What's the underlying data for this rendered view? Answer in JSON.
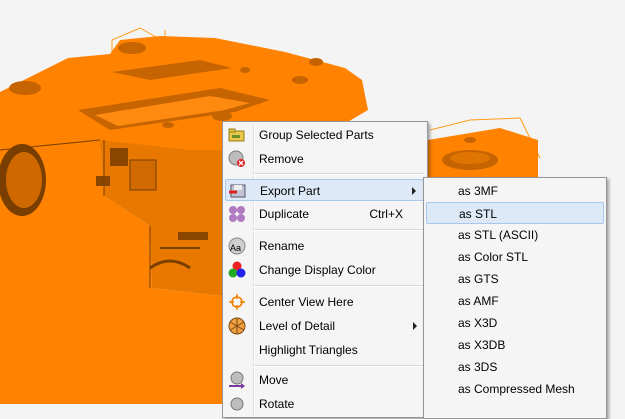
{
  "context_menu": {
    "items": [
      {
        "label": "Group Selected Parts",
        "icon": "group-folder-icon"
      },
      {
        "label": "Remove",
        "icon": "remove-icon"
      },
      {
        "label": "Export Part",
        "icon": "export-icon",
        "has_submenu": true,
        "highlighted": true
      },
      {
        "label": "Duplicate",
        "icon": "duplicate-icon",
        "shortcut": "Ctrl+X"
      },
      {
        "label": "Rename",
        "icon": "rename-icon"
      },
      {
        "label": "Change Display Color",
        "icon": "color-icon"
      },
      {
        "label": "Center View Here",
        "icon": "center-target-icon"
      },
      {
        "label": "Level of Detail",
        "icon": "level-of-detail-icon",
        "has_submenu": true
      },
      {
        "label": "Highlight Triangles",
        "icon": ""
      },
      {
        "label": "Move",
        "icon": "move-icon"
      },
      {
        "label": "Rotate",
        "icon": "rotate-icon"
      }
    ]
  },
  "export_submenu": {
    "items": [
      {
        "label": "as 3MF"
      },
      {
        "label": "as STL",
        "highlighted": true
      },
      {
        "label": "as STL (ASCII)"
      },
      {
        "label": "as Color STL"
      },
      {
        "label": "as GTS"
      },
      {
        "label": "as AMF"
      },
      {
        "label": "as X3D"
      },
      {
        "label": "as X3DB"
      },
      {
        "label": "as 3DS"
      },
      {
        "label": "as Compressed Mesh"
      }
    ]
  },
  "colors": {
    "part": "#ff8000",
    "part_dark": "#b85a00",
    "menu_bg": "#f5f5f5",
    "highlight": "#dde9f7"
  }
}
